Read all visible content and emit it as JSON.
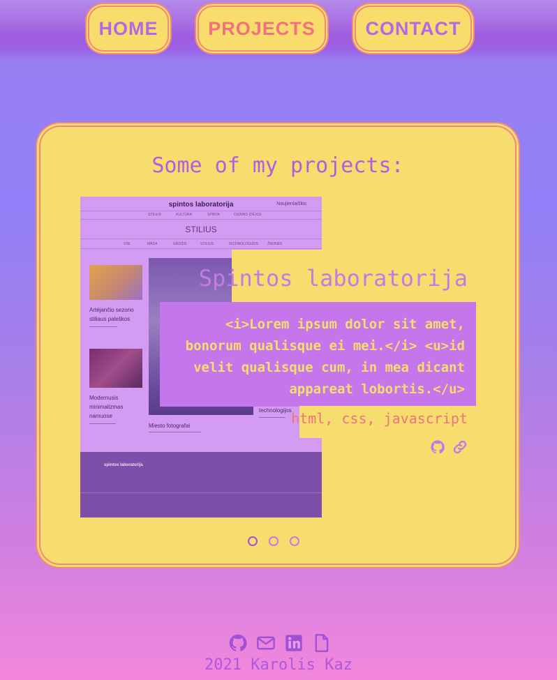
{
  "nav": {
    "home": "HOME",
    "projects": "PROJECTS",
    "contact": "CONTACT"
  },
  "projects": {
    "heading": "Some of my projects:",
    "current": {
      "title": "Spintos laboratorija",
      "description": "<i>Lorem ipsum dolor sit amet, bonorum qualisque ei mei.</i> <u>id velit qualisque cum, in mea dicant appareat lobortis.</u>",
      "tech": "html, css, javascript",
      "links": [
        "github-icon",
        "link-icon"
      ]
    },
    "screenshot": {
      "brand": "spintos laboratorija",
      "newsletter": "Naujienlaiškis",
      "menu_top": [
        "STILIUS",
        "KULTŪRA",
        "SPINTA",
        "DIZAINO IDĖJOS"
      ],
      "section": "STILIUS",
      "menu_sub": [
        "VISI",
        "MADA",
        "GROŽIS",
        "STILIUS",
        "TECHNOLOGIJOS",
        "ŽMONĖS"
      ],
      "article1": "Artėjančio sezono stiliaus paleškos",
      "article2": "Modernusis minimalizmas namuose",
      "article3": "Miesto fotografai",
      "article4": "technologijos",
      "footer_brand": "spintos laboratorija"
    },
    "slides": 3,
    "active_slide": 1
  },
  "footer": {
    "icons": [
      "github-icon",
      "mail-icon",
      "linkedin-icon",
      "file-icon"
    ],
    "copyright": "2021 Karolis Kaz"
  },
  "colors": {
    "card": "#f7dd6e",
    "accent_pink": "#f0727c",
    "accent_purple": "#c476ea"
  }
}
